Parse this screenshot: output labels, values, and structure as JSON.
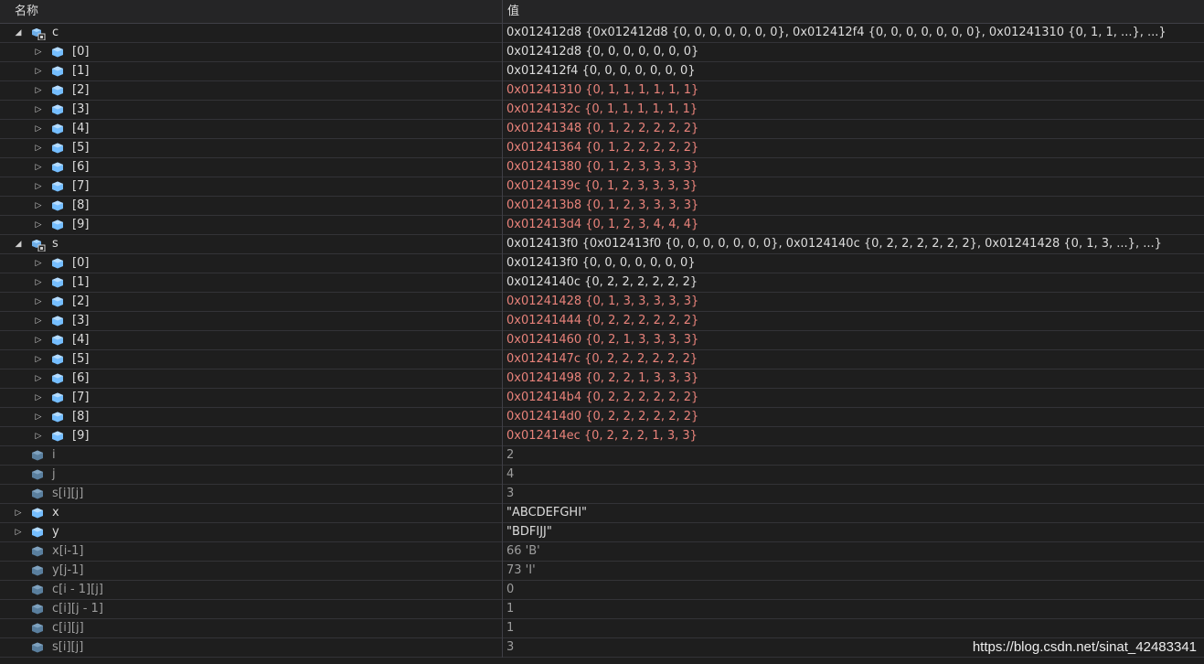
{
  "header": {
    "name_col": "名称",
    "value_col": "值"
  },
  "rows": [
    {
      "name": "c",
      "value": "0x012412d8 {0x012412d8 {0, 0, 0, 0, 0, 0, 0}, 0x012412f4 {0, 0, 0, 0, 0, 0, 0}, 0x01241310 {0, 1, 1, ...}, ...}",
      "level": 0,
      "expander": "expanded",
      "icon": "array-object-icon",
      "state": "normal"
    },
    {
      "name": "[0]",
      "value": "0x012412d8 {0, 0, 0, 0, 0, 0, 0}",
      "level": 1,
      "expander": "collapsed",
      "icon": "object-icon",
      "state": "normal"
    },
    {
      "name": "[1]",
      "value": "0x012412f4 {0, 0, 0, 0, 0, 0, 0}",
      "level": 1,
      "expander": "collapsed",
      "icon": "object-icon",
      "state": "normal"
    },
    {
      "name": "[2]",
      "value": "0x01241310 {0, 1, 1, 1, 1, 1, 1}",
      "level": 1,
      "expander": "collapsed",
      "icon": "object-icon",
      "state": "changed"
    },
    {
      "name": "[3]",
      "value": "0x0124132c {0, 1, 1, 1, 1, 1, 1}",
      "level": 1,
      "expander": "collapsed",
      "icon": "object-icon",
      "state": "changed"
    },
    {
      "name": "[4]",
      "value": "0x01241348 {0, 1, 2, 2, 2, 2, 2}",
      "level": 1,
      "expander": "collapsed",
      "icon": "object-icon",
      "state": "changed"
    },
    {
      "name": "[5]",
      "value": "0x01241364 {0, 1, 2, 2, 2, 2, 2}",
      "level": 1,
      "expander": "collapsed",
      "icon": "object-icon",
      "state": "changed"
    },
    {
      "name": "[6]",
      "value": "0x01241380 {0, 1, 2, 3, 3, 3, 3}",
      "level": 1,
      "expander": "collapsed",
      "icon": "object-icon",
      "state": "changed"
    },
    {
      "name": "[7]",
      "value": "0x0124139c {0, 1, 2, 3, 3, 3, 3}",
      "level": 1,
      "expander": "collapsed",
      "icon": "object-icon",
      "state": "changed"
    },
    {
      "name": "[8]",
      "value": "0x012413b8 {0, 1, 2, 3, 3, 3, 3}",
      "level": 1,
      "expander": "collapsed",
      "icon": "object-icon",
      "state": "changed"
    },
    {
      "name": "[9]",
      "value": "0x012413d4 {0, 1, 2, 3, 4, 4, 4}",
      "level": 1,
      "expander": "collapsed",
      "icon": "object-icon",
      "state": "changed"
    },
    {
      "name": "s",
      "value": "0x012413f0 {0x012413f0 {0, 0, 0, 0, 0, 0, 0}, 0x0124140c {0, 2, 2, 2, 2, 2, 2}, 0x01241428 {0, 1, 3, ...}, ...}",
      "level": 0,
      "expander": "expanded",
      "icon": "array-object-icon",
      "state": "normal"
    },
    {
      "name": "[0]",
      "value": "0x012413f0 {0, 0, 0, 0, 0, 0, 0}",
      "level": 1,
      "expander": "collapsed",
      "icon": "object-icon",
      "state": "normal"
    },
    {
      "name": "[1]",
      "value": "0x0124140c {0, 2, 2, 2, 2, 2, 2}",
      "level": 1,
      "expander": "collapsed",
      "icon": "object-icon",
      "state": "normal"
    },
    {
      "name": "[2]",
      "value": "0x01241428 {0, 1, 3, 3, 3, 3, 3}",
      "level": 1,
      "expander": "collapsed",
      "icon": "object-icon",
      "state": "changed"
    },
    {
      "name": "[3]",
      "value": "0x01241444 {0, 2, 2, 2, 2, 2, 2}",
      "level": 1,
      "expander": "collapsed",
      "icon": "object-icon",
      "state": "changed"
    },
    {
      "name": "[4]",
      "value": "0x01241460 {0, 2, 1, 3, 3, 3, 3}",
      "level": 1,
      "expander": "collapsed",
      "icon": "object-icon",
      "state": "changed"
    },
    {
      "name": "[5]",
      "value": "0x0124147c {0, 2, 2, 2, 2, 2, 2}",
      "level": 1,
      "expander": "collapsed",
      "icon": "object-icon",
      "state": "changed"
    },
    {
      "name": "[6]",
      "value": "0x01241498 {0, 2, 2, 1, 3, 3, 3}",
      "level": 1,
      "expander": "collapsed",
      "icon": "object-icon",
      "state": "changed"
    },
    {
      "name": "[7]",
      "value": "0x012414b4 {0, 2, 2, 2, 2, 2, 2}",
      "level": 1,
      "expander": "collapsed",
      "icon": "object-icon",
      "state": "changed"
    },
    {
      "name": "[8]",
      "value": "0x012414d0 {0, 2, 2, 2, 2, 2, 2}",
      "level": 1,
      "expander": "collapsed",
      "icon": "object-icon",
      "state": "changed"
    },
    {
      "name": "[9]",
      "value": "0x012414ec {0, 2, 2, 2, 1, 3, 3}",
      "level": 1,
      "expander": "collapsed",
      "icon": "object-icon",
      "state": "changed"
    },
    {
      "name": "i",
      "value": "2",
      "level": 0,
      "expander": "none",
      "icon": "object-icon",
      "state": "stale"
    },
    {
      "name": "j",
      "value": "4",
      "level": 0,
      "expander": "none",
      "icon": "object-icon",
      "state": "stale"
    },
    {
      "name": "s[i][j]",
      "value": "3",
      "level": 0,
      "expander": "none",
      "icon": "object-icon",
      "state": "stale"
    },
    {
      "name": "x",
      "value": "\"ABCDEFGHI\"",
      "level": 0,
      "expander": "collapsed",
      "icon": "object-icon",
      "state": "normal"
    },
    {
      "name": "y",
      "value": "\"BDFIJJ\"",
      "level": 0,
      "expander": "collapsed",
      "icon": "object-icon",
      "state": "normal"
    },
    {
      "name": "x[i-1]",
      "value": "66 'B'",
      "level": 0,
      "expander": "none",
      "icon": "object-icon",
      "state": "stale"
    },
    {
      "name": "y[j-1]",
      "value": "73 'I'",
      "level": 0,
      "expander": "none",
      "icon": "object-icon",
      "state": "stale"
    },
    {
      "name": "c[i - 1][j]",
      "value": "0",
      "level": 0,
      "expander": "none",
      "icon": "object-icon",
      "state": "stale"
    },
    {
      "name": "c[i][j - 1]",
      "value": "1",
      "level": 0,
      "expander": "none",
      "icon": "object-icon",
      "state": "stale"
    },
    {
      "name": "c[i][j]",
      "value": "1",
      "level": 0,
      "expander": "none",
      "icon": "object-icon",
      "state": "stale"
    },
    {
      "name": "s[i][j]",
      "value": "3",
      "level": 0,
      "expander": "none",
      "icon": "object-icon",
      "state": "stale"
    }
  ],
  "watermark": "https://blog.csdn.net/sinat_42483341",
  "colors": {
    "background": "#1e1e1e",
    "text": "#dcdcdc",
    "changed_value": "#e8827a",
    "stale_text": "#9d9d9d",
    "icon_blue": "#75beff"
  }
}
